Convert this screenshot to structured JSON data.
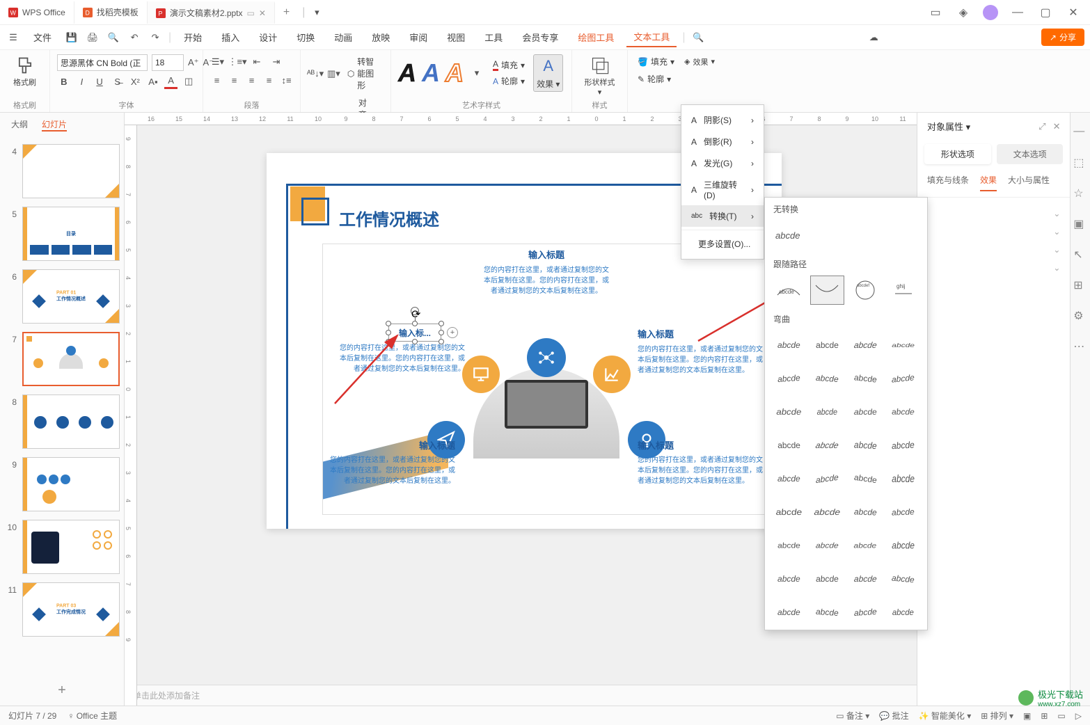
{
  "titlebar": {
    "tabs": [
      {
        "icon": "wps",
        "label": "WPS Office"
      },
      {
        "icon": "template",
        "label": "找稻壳模板"
      },
      {
        "icon": "ppt",
        "label": "演示文稿素材2.pptx",
        "active": true
      }
    ]
  },
  "menubar": {
    "file": "文件",
    "items": [
      "开始",
      "插入",
      "设计",
      "切换",
      "动画",
      "放映",
      "审阅",
      "视图",
      "工具",
      "会员专享"
    ],
    "special": [
      "绘图工具",
      "文本工具"
    ],
    "active": "文本工具",
    "share": "分享"
  },
  "ribbon": {
    "format_painter": "格式刷",
    "group_format": "格式刷",
    "font_name": "思源黑体 CN Bold (正",
    "font_size": "18",
    "group_font": "字体",
    "group_para": "段落",
    "smart_shape": "转智能图形",
    "align_text": "对齐文本",
    "group_wordart": "艺术字样式",
    "fill": "填充",
    "outline": "轮廓",
    "effect": "效果",
    "shape_style": "形状样式",
    "group_style": "样式",
    "fill2": "填充",
    "outline2": "轮廓",
    "effect2": "效果"
  },
  "effect_menu": {
    "shadow": "阴影(S)",
    "reflection": "倒影(R)",
    "glow": "发光(G)",
    "rotation3d": "三维旋转(D)",
    "transform": "转换(T)",
    "more": "更多设置(O)..."
  },
  "transform_panel": {
    "no_transform": "无转换",
    "plain": "abcde",
    "follow_path": "跟随路径",
    "warp": "弯曲",
    "sample": "abcde",
    "path_sample": "abcdefghij"
  },
  "left_panel": {
    "outline": "大纲",
    "slides": "幻灯片",
    "slide_nums": [
      "4",
      "5",
      "6",
      "7",
      "8",
      "9",
      "10",
      "11"
    ]
  },
  "slide": {
    "title": "工作情况概述",
    "heading": "输入标题",
    "body": "您的内容打在这里，或者通过复制您的文本后复制在这里。您的内容打在这里，或者通过复制您的文本后复制在这里。",
    "body_short": "您的内容打在这里，或者通过复制您的文本后复制在这里。",
    "selected": "输入标..."
  },
  "properties": {
    "title": "对象属性",
    "shape_tab": "形状选项",
    "text_tab": "文本选项",
    "fill_line": "填充与线条",
    "effects": "效果",
    "size_props": "大小与属性"
  },
  "notes": "单击此处添加备注",
  "status": {
    "slide": "幻灯片 7 / 29",
    "theme": "Office 主题",
    "notes_btn": "备注",
    "comment": "批注",
    "smart": "智能美化",
    "arrange": "排列"
  },
  "watermark": {
    "name": "极光下载站",
    "url": "www.xz7.com"
  },
  "thumbs": {
    "t5_title": "目录",
    "t6_sub": "工作情况概述",
    "part": "PART 01",
    "part3": "PART 03",
    "t11_sub": "工作完成情况"
  }
}
